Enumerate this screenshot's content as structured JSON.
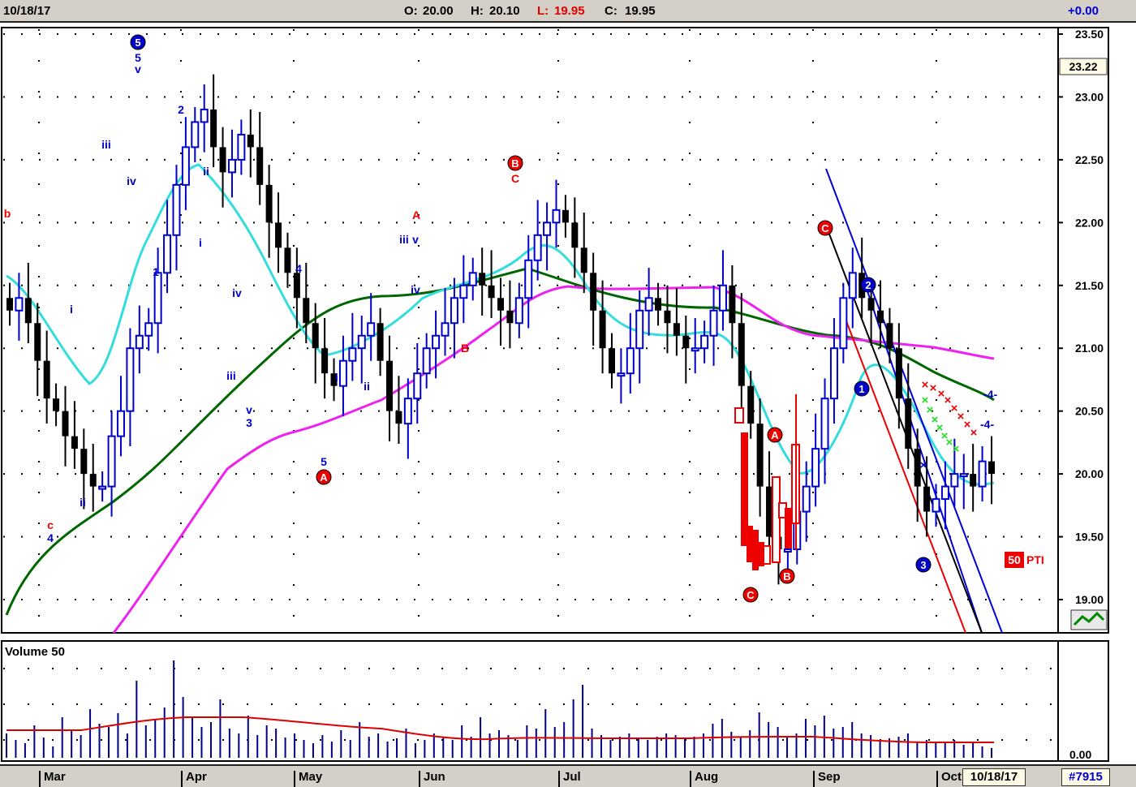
{
  "header": {
    "date": "10/18/17",
    "open_label": "O:",
    "open": "20.00",
    "high_label": "H:",
    "high": "20.10",
    "low_label": "L:",
    "low": "19.95",
    "close_label": "C:",
    "close": "19.95",
    "change": "+0.00"
  },
  "footer": {
    "months": [
      "Mar",
      "Apr",
      "May",
      "Jun",
      "Jul",
      "Aug",
      "Sep",
      "Oct"
    ],
    "cursor_date": "10/18/17",
    "symbol_id": "#7915"
  },
  "price_panel": {
    "last_price_label": "23.22",
    "pti_value": "50",
    "pti_label": "PTI"
  },
  "volume_panel": {
    "title": "Volume 50",
    "axis_label": "0.00"
  },
  "colors": {
    "up": "#0000cc",
    "down": "#000000",
    "red_bars": "#ee0000",
    "ma_cyan": "#33dddd",
    "ma_green": "#006600",
    "ma_magenta": "#ee22ee",
    "volume": "#000088",
    "volume_avg": "#dd0000"
  },
  "chart_data": {
    "type": "candlestick",
    "title": "",
    "xlabel": "",
    "ylabel": "",
    "ylim": [
      18.8,
      23.6
    ],
    "yticks": [
      "23.50",
      "23.00",
      "22.50",
      "22.00",
      "21.50",
      "21.00",
      "20.50",
      "20.00",
      "19.50",
      "19.00"
    ],
    "x": [
      "Mar",
      "Apr",
      "May",
      "Jun",
      "Jul",
      "Aug",
      "Sep",
      "Oct"
    ],
    "series": [
      {
        "values": [
          21.3,
          21.4,
          21.2,
          20.9,
          20.6,
          20.5,
          20.3,
          20.2,
          20.0,
          19.9,
          19.9,
          20.3,
          20.5,
          21.0,
          21.1,
          21.2,
          21.6,
          21.9,
          22.3,
          22.6,
          22.8,
          22.9,
          22.6,
          22.4,
          22.5,
          22.7,
          22.6,
          22.3,
          22.0,
          21.8,
          21.6,
          21.4,
          21.2,
          21.0,
          20.8,
          20.7,
          20.9,
          21.0,
          21.1,
          21.2,
          20.9,
          20.5,
          20.4,
          20.6,
          20.8,
          21.0,
          21.1,
          21.2,
          21.4,
          21.5,
          21.6,
          21.5,
          21.4,
          21.3,
          21.2,
          21.4,
          21.7,
          21.9,
          22.0,
          22.1,
          22.0,
          21.8,
          21.6,
          21.3,
          21.0,
          20.8,
          20.8,
          21.0,
          21.3,
          21.4,
          21.3,
          21.2,
          21.1,
          21.0,
          21.0,
          21.1,
          21.3,
          21.5,
          21.2,
          20.7,
          20.4,
          19.9,
          19.5,
          19.4,
          19.4,
          19.7,
          19.9,
          20.2,
          20.6,
          21.0,
          21.4,
          21.6,
          21.4,
          21.3,
          21.2,
          21.0,
          20.6,
          20.2,
          19.9,
          19.7,
          19.8,
          19.9,
          20.0,
          20.0,
          19.9,
          20.1,
          20.0
        ]
      }
    ]
  }
}
